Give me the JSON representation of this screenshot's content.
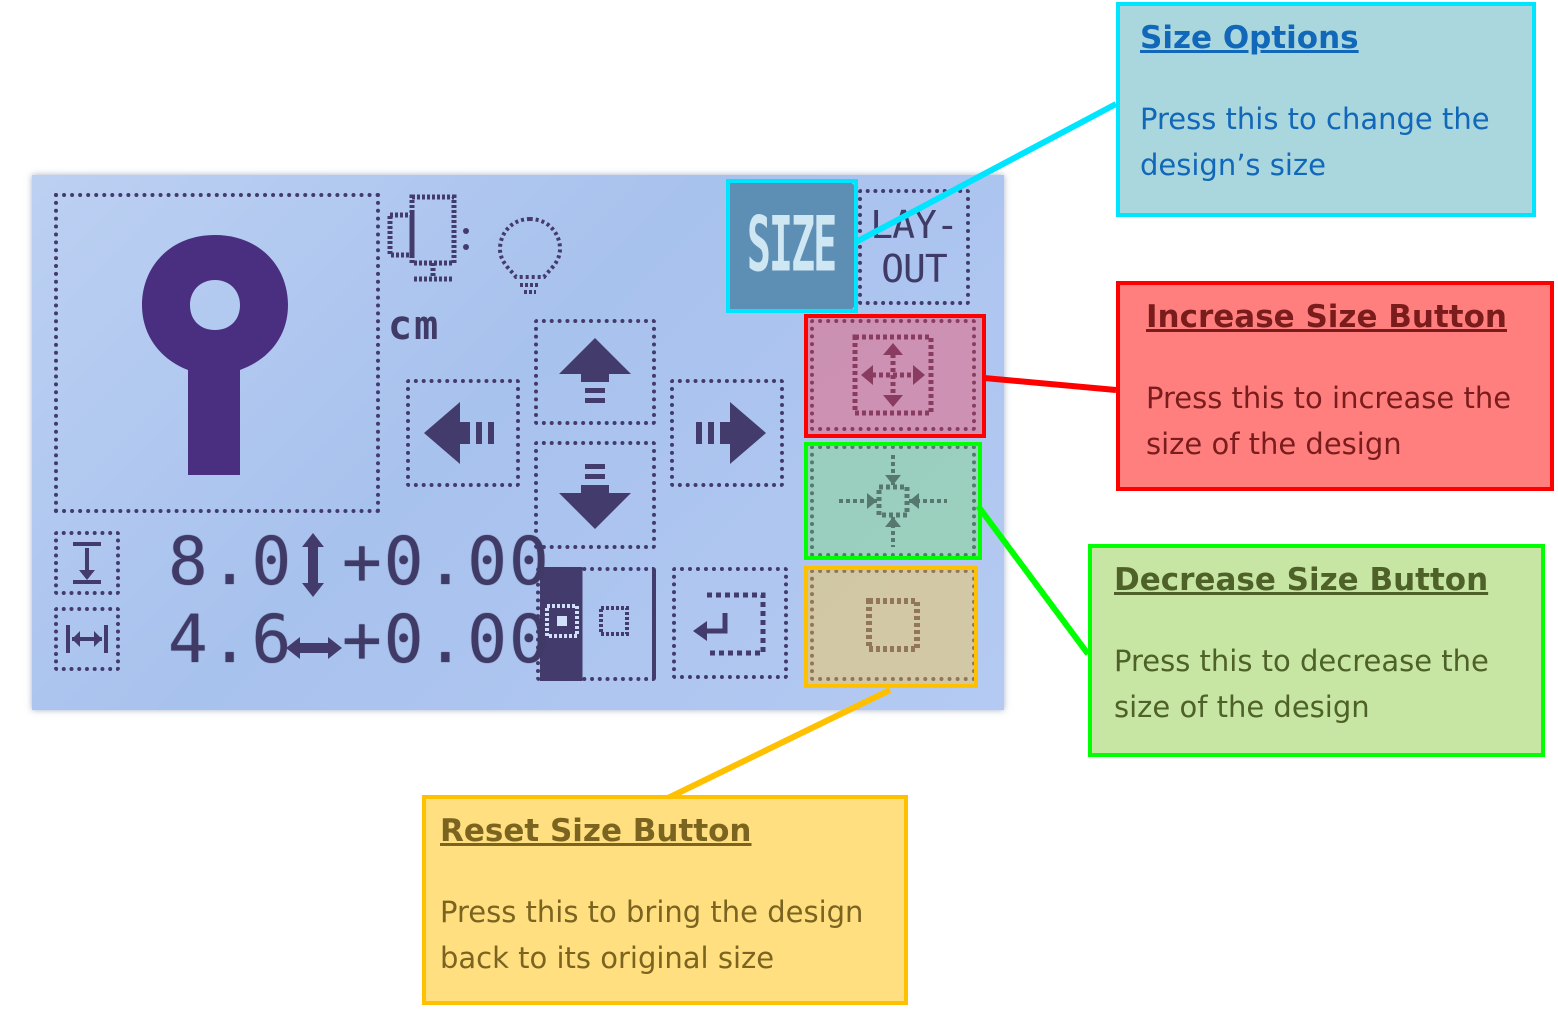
{
  "lcd": {
    "unit_label": "cm",
    "height_value": "8.0",
    "height_offset": "+0.00",
    "width_value": "4.6",
    "width_offset": "+0.00",
    "size_tab_label": "SIZE",
    "layout_tab_label_top": "LAY-",
    "layout_tab_label_bottom": "OUT",
    "icons": {
      "design_preview": "key-shape-icon",
      "hoop": "hoop-icon",
      "bulb": "bulb-icon",
      "arrow_up": "arrow-up-icon",
      "arrow_down": "arrow-down-icon",
      "arrow_left": "arrow-left-icon",
      "arrow_right": "arrow-right-icon",
      "height": "height-icon",
      "width": "width-icon",
      "center": "center-icon",
      "return": "return-icon",
      "increase": "increase-size-icon",
      "decrease": "decrease-size-icon",
      "reset": "reset-size-icon"
    }
  },
  "callouts": {
    "size_options": {
      "title": "Size Options",
      "body_line1": "Press this to change the",
      "body_line2": "design’s size",
      "color": "#00e5ff"
    },
    "increase": {
      "title": "Increase Size Button",
      "body_line1": "Press this to increase the",
      "body_line2": "size of the design",
      "color": "#ff0000"
    },
    "decrease": {
      "title": "Decrease Size Button",
      "body_line1": "Press this to decrease the",
      "body_line2": "size of the design",
      "color": "#00ff00"
    },
    "reset": {
      "title": "Reset Size Button",
      "body_line1": "Press this to bring the design",
      "body_line2": "back to its original size",
      "color": "#ffc000"
    }
  }
}
